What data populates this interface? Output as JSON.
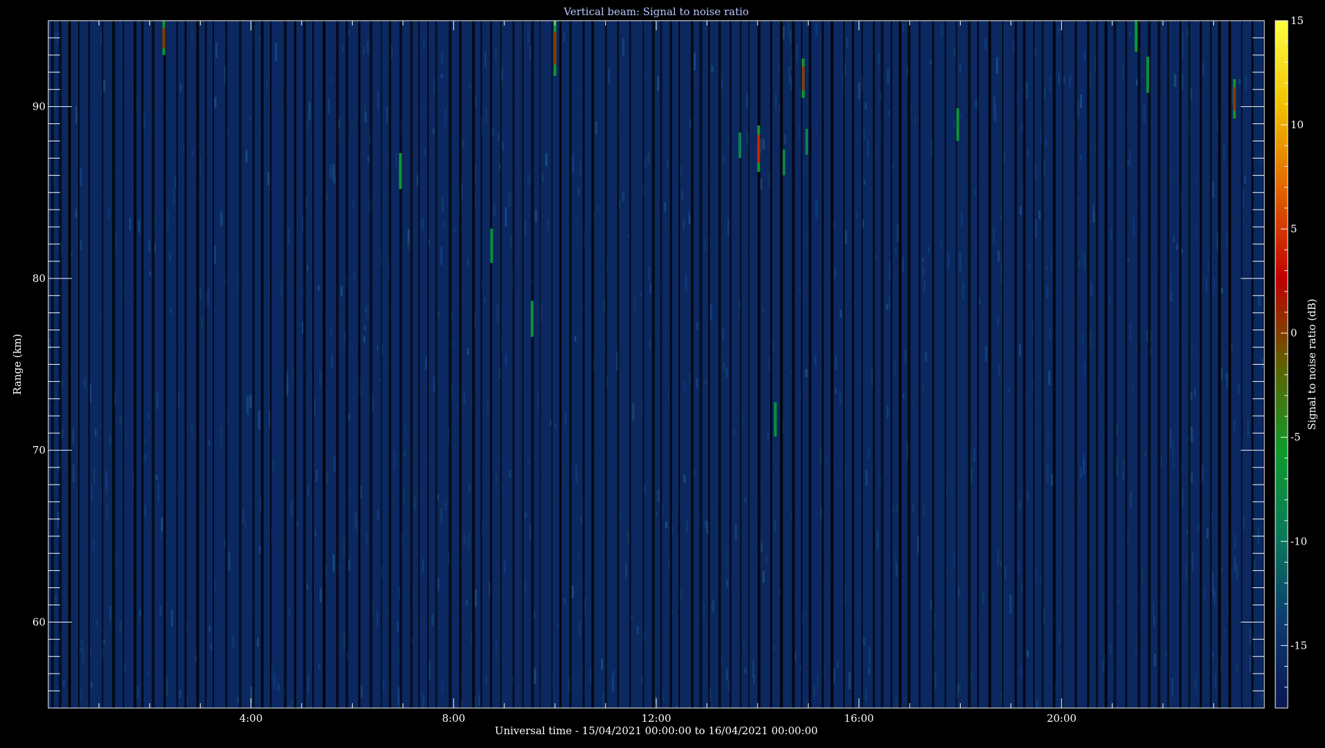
{
  "chart_data": {
    "type": "heatmap",
    "title": "Vertical beam: Signal to noise ratio",
    "xlabel": "Universal time - 15/04/2021 00:00:00 to 16/04/2021 00:00:00",
    "ylabel": "Range (km)",
    "xlim_hours": [
      0,
      24
    ],
    "ylim_km": [
      55,
      95
    ],
    "x_ticks": [
      {
        "hours": 4,
        "label": "4:00"
      },
      {
        "hours": 8,
        "label": "8:00"
      },
      {
        "hours": 12,
        "label": "12:00"
      },
      {
        "hours": 16,
        "label": "16:00"
      },
      {
        "hours": 20,
        "label": "20:00"
      }
    ],
    "y_ticks": [
      {
        "km": 60,
        "label": "60"
      },
      {
        "km": 70,
        "label": "70"
      },
      {
        "km": 80,
        "label": "80"
      },
      {
        "km": 90,
        "label": "90"
      }
    ],
    "colorbar": {
      "label": "Signal to noise ratio (dB)",
      "range": [
        -18,
        15
      ],
      "ticks": [
        {
          "value": 15,
          "label": "15"
        },
        {
          "value": 10,
          "label": "10"
        },
        {
          "value": 5,
          "label": "5"
        },
        {
          "value": 0,
          "label": "0"
        },
        {
          "value": -5,
          "label": "-5"
        },
        {
          "value": -10,
          "label": "-10"
        },
        {
          "value": -15,
          "label": "-15"
        }
      ],
      "stops": [
        "#0a1850",
        "#0c3a70",
        "#0a7a5a",
        "#0f9a2a",
        "#606000",
        "#c00000",
        "#e06000",
        "#f0c000",
        "#ffff40"
      ]
    },
    "background_snr_db": -16,
    "echoes": [
      {
        "time_h": 2.28,
        "range_top_km": 95.0,
        "range_bottom_km": 93.0,
        "snr_db": 0
      },
      {
        "time_h": 10.0,
        "range_top_km": 95.0,
        "range_bottom_km": 91.8,
        "snr_db": 0
      },
      {
        "time_h": 14.02,
        "range_top_km": 88.9,
        "range_bottom_km": 86.2,
        "snr_db": 4
      },
      {
        "time_h": 14.9,
        "range_top_km": 92.8,
        "range_bottom_km": 90.5,
        "snr_db": 0
      },
      {
        "time_h": 23.41,
        "range_top_km": 91.6,
        "range_bottom_km": 89.3,
        "snr_db": 0
      },
      {
        "time_h": 6.95,
        "range_top_km": 87.3,
        "range_bottom_km": 85.2,
        "snr_db": -6
      },
      {
        "time_h": 8.75,
        "range_top_km": 82.9,
        "range_bottom_km": 80.9,
        "snr_db": -7
      },
      {
        "time_h": 9.55,
        "range_top_km": 78.7,
        "range_bottom_km": 76.6,
        "snr_db": -7
      },
      {
        "time_h": 14.35,
        "range_top_km": 72.8,
        "range_bottom_km": 70.8,
        "snr_db": -7
      },
      {
        "time_h": 17.95,
        "range_top_km": 89.9,
        "range_bottom_km": 88.0,
        "snr_db": -7
      },
      {
        "time_h": 21.47,
        "range_top_km": 95.0,
        "range_bottom_km": 93.2,
        "snr_db": -6
      },
      {
        "time_h": 21.7,
        "range_top_km": 92.9,
        "range_bottom_km": 90.8,
        "snr_db": -7
      },
      {
        "time_h": 13.65,
        "range_top_km": 88.5,
        "range_bottom_km": 87.0,
        "snr_db": -9
      },
      {
        "time_h": 14.52,
        "range_top_km": 87.5,
        "range_bottom_km": 86.0,
        "snr_db": -9
      },
      {
        "time_h": 14.97,
        "range_top_km": 88.7,
        "range_bottom_km": 87.2,
        "snr_db": -9
      }
    ]
  }
}
